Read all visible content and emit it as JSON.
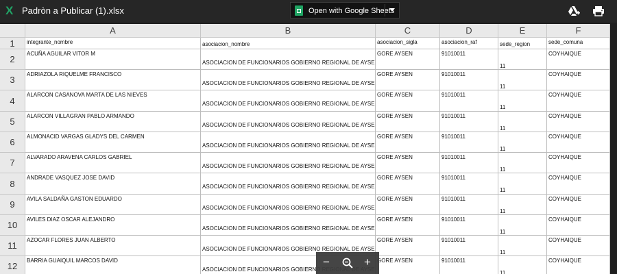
{
  "topbar": {
    "file_name": "Padròn a Publicar (1).xlsx",
    "open_button_label": "Open with Google Sheets",
    "app_icon_letter": "X",
    "icons": [
      "excel-icon",
      "add-to-drive-icon",
      "print-icon",
      "chevron-down-icon"
    ]
  },
  "sheet": {
    "columns": [
      "A",
      "B",
      "C",
      "D",
      "E",
      "F"
    ],
    "row_numbers": [
      "1",
      "2",
      "3",
      "4",
      "5",
      "6",
      "7",
      "8",
      "9",
      "10",
      "11",
      "12"
    ],
    "header_row": [
      "integrante_nombre",
      "asociacion_nombre",
      "asociacion_sigla",
      "asociacion_raf",
      "sede_region",
      "sede_comuna"
    ],
    "rows": [
      [
        "ACUÑA AGUILAR VITOR M",
        "ASOCIACION DE FUNCIONARIOS GOBIERNO REGIONAL DE AYSEN",
        "GORE AYSEN",
        "91010011",
        "11",
        "COYHAIQUE"
      ],
      [
        "ADRIAZOLA RIQUELME FRANCISCO",
        "ASOCIACION DE FUNCIONARIOS GOBIERNO REGIONAL DE AYSEN",
        "GORE AYSEN",
        "91010011",
        "11",
        "COYHAIQUE"
      ],
      [
        "ALARCON CASANOVA MARTA DE LAS NIEVES",
        "ASOCIACION DE FUNCIONARIOS GOBIERNO REGIONAL DE AYSEN",
        "GORE AYSEN",
        "91010011",
        "11",
        "COYHAIQUE"
      ],
      [
        "ALARCON VILLAGRAN PABLO ARMANDO",
        "ASOCIACION DE FUNCIONARIOS GOBIERNO REGIONAL DE AYSEN",
        "GORE AYSEN",
        "91010011",
        "11",
        "COYHAIQUE"
      ],
      [
        "ALMONACID VARGAS GLADYS DEL CARMEN",
        "ASOCIACION DE FUNCIONARIOS GOBIERNO REGIONAL DE AYSEN",
        "GORE AYSEN",
        "91010011",
        "11",
        "COYHAIQUE"
      ],
      [
        "ALVARADO ARAVENA CARLOS GABRIEL",
        "ASOCIACION DE FUNCIONARIOS GOBIERNO REGIONAL DE AYSEN",
        "GORE AYSEN",
        "91010011",
        "11",
        "COYHAIQUE"
      ],
      [
        "ANDRADE VASQUEZ JOSE DAVID",
        "ASOCIACION DE FUNCIONARIOS GOBIERNO REGIONAL DE AYSEN",
        "GORE AYSEN",
        "91010011",
        "11",
        "COYHAIQUE"
      ],
      [
        "AVILA SALDAÑA GASTON EDUARDO",
        "ASOCIACION DE FUNCIONARIOS GOBIERNO REGIONAL DE AYSEN",
        "GORE AYSEN",
        "91010011",
        "11",
        "COYHAIQUE"
      ],
      [
        "AVILES DIAZ OSCAR ALEJANDRO",
        "ASOCIACION DE FUNCIONARIOS GOBIERNO REGIONAL DE AYSEN",
        "GORE AYSEN",
        "91010011",
        "11",
        "COYHAIQUE"
      ],
      [
        "AZOCAR FLORES JUAN ALBERTO",
        "ASOCIACION DE FUNCIONARIOS GOBIERNO REGIONAL DE AYSEN",
        "GORE AYSEN",
        "91010011",
        "11",
        "COYHAIQUE"
      ],
      [
        "BARRIA GUAIQUIL MARCOS DAVID",
        "ASOCIACION DE FUNCIONARIOS GOBIERNO REGIONAL DE AYSEN",
        "GORE AYSEN",
        "91010011",
        "11",
        "COYHAIQUE"
      ]
    ]
  },
  "zoom_controls": {
    "zoom_out": "−",
    "zoom_in": "+",
    "icons": [
      "zoom-out-icon",
      "magnifier-icon",
      "zoom-in-icon"
    ]
  }
}
